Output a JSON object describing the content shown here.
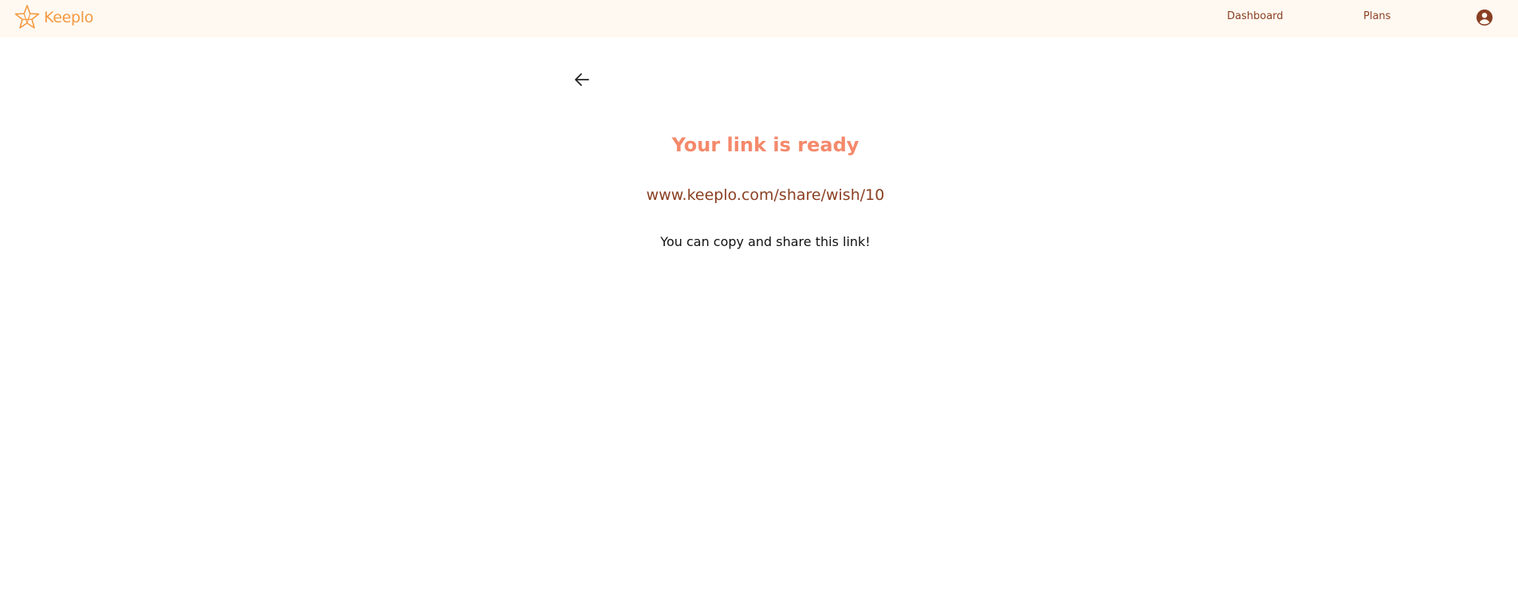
{
  "header": {
    "brand": "Keeplo",
    "nav": {
      "dashboard_label": "Dashboard",
      "plans_label": "Plans"
    },
    "icons": {
      "logo": "star-logo-icon",
      "account": "account-circle-icon"
    }
  },
  "main": {
    "back_icon": "arrow-left-icon",
    "title": "Your link is ready",
    "link": "www.keeplo.com/share/wish/10",
    "hint": "You can copy and share this link!"
  },
  "colors": {
    "brand_orange": "#f49a42",
    "title_salmon": "#f4896b",
    "link_brown": "#8a3f22",
    "header_bg": "#fff9f2"
  }
}
